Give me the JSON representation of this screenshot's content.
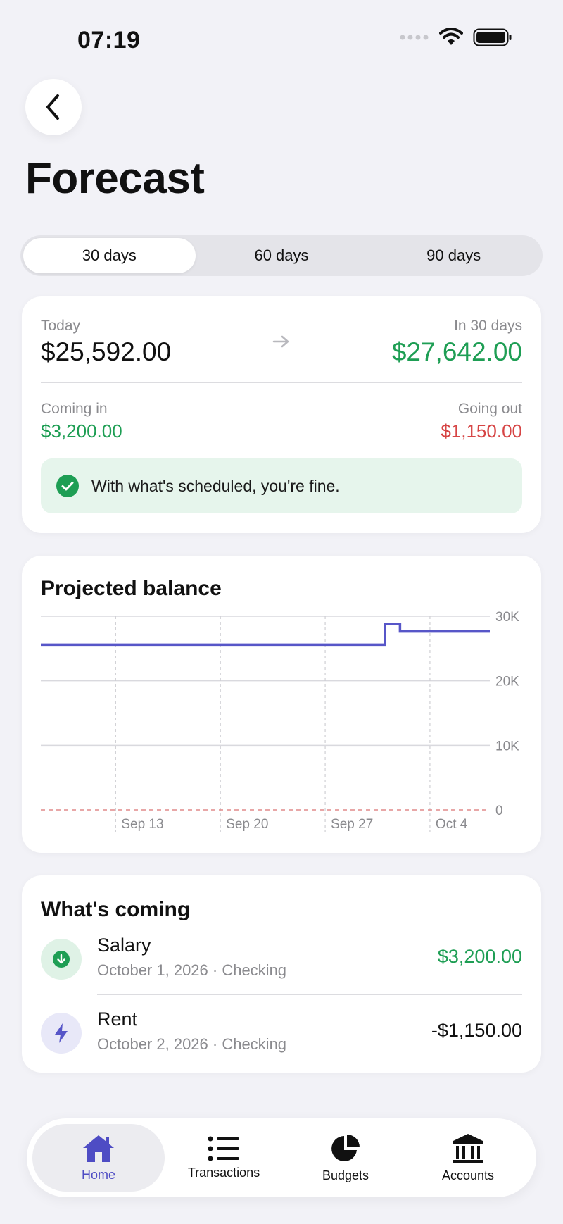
{
  "status": {
    "time": "07:19"
  },
  "header": {
    "title": "Forecast"
  },
  "segments": [
    {
      "label": "30 days",
      "active": true
    },
    {
      "label": "60 days",
      "active": false
    },
    {
      "label": "90 days",
      "active": false
    }
  ],
  "summary": {
    "today_label": "Today",
    "today_value": "$25,592.00",
    "future_label": "In 30 days",
    "future_value": "$27,642.00",
    "in_label": "Coming in",
    "in_value": "$3,200.00",
    "out_label": "Going out",
    "out_value": "$1,150.00",
    "message": "With what's scheduled, you're fine.",
    "colors": {
      "positive": "#1e9e54",
      "negative": "#d64545"
    }
  },
  "chart_title": "Projected balance",
  "chart_data": {
    "type": "line",
    "title": "Projected balance",
    "x_tick_labels": [
      "Sep 13",
      "Sep 20",
      "Sep 27",
      "Oct 4"
    ],
    "y_tick_labels": [
      "30K",
      "20K",
      "10K",
      "0"
    ],
    "ylim": [
      0,
      30000
    ],
    "x": [
      "2026-09-08",
      "2026-09-30",
      "2026-10-01",
      "2026-10-02",
      "2026-10-08"
    ],
    "values": [
      25592,
      25592,
      28792,
      27642,
      27642
    ],
    "step": true,
    "zero_line": {
      "style": "dashed",
      "color": "#e08a8a"
    },
    "line_color": "#5756c8",
    "grid": true
  },
  "coming": {
    "title": "What's coming",
    "items": [
      {
        "name": "Salary",
        "sub": "October 1, 2026 · Checking",
        "amount": "$3,200.00",
        "icon": "arrow-down-circle-icon",
        "color": "#1e9e54"
      },
      {
        "name": "Rent",
        "sub": "October 2, 2026 · Checking",
        "amount": "-$1,150.00",
        "icon": "bolt-icon",
        "color": "#111111"
      }
    ]
  },
  "tabs": [
    {
      "label": "Home",
      "icon": "house-icon",
      "active": true
    },
    {
      "label": "Transactions",
      "icon": "list-icon",
      "active": false
    },
    {
      "label": "Budgets",
      "icon": "pie-chart-icon",
      "active": false
    },
    {
      "label": "Accounts",
      "icon": "bank-icon",
      "active": false
    }
  ],
  "accent": "#4e4cc4"
}
